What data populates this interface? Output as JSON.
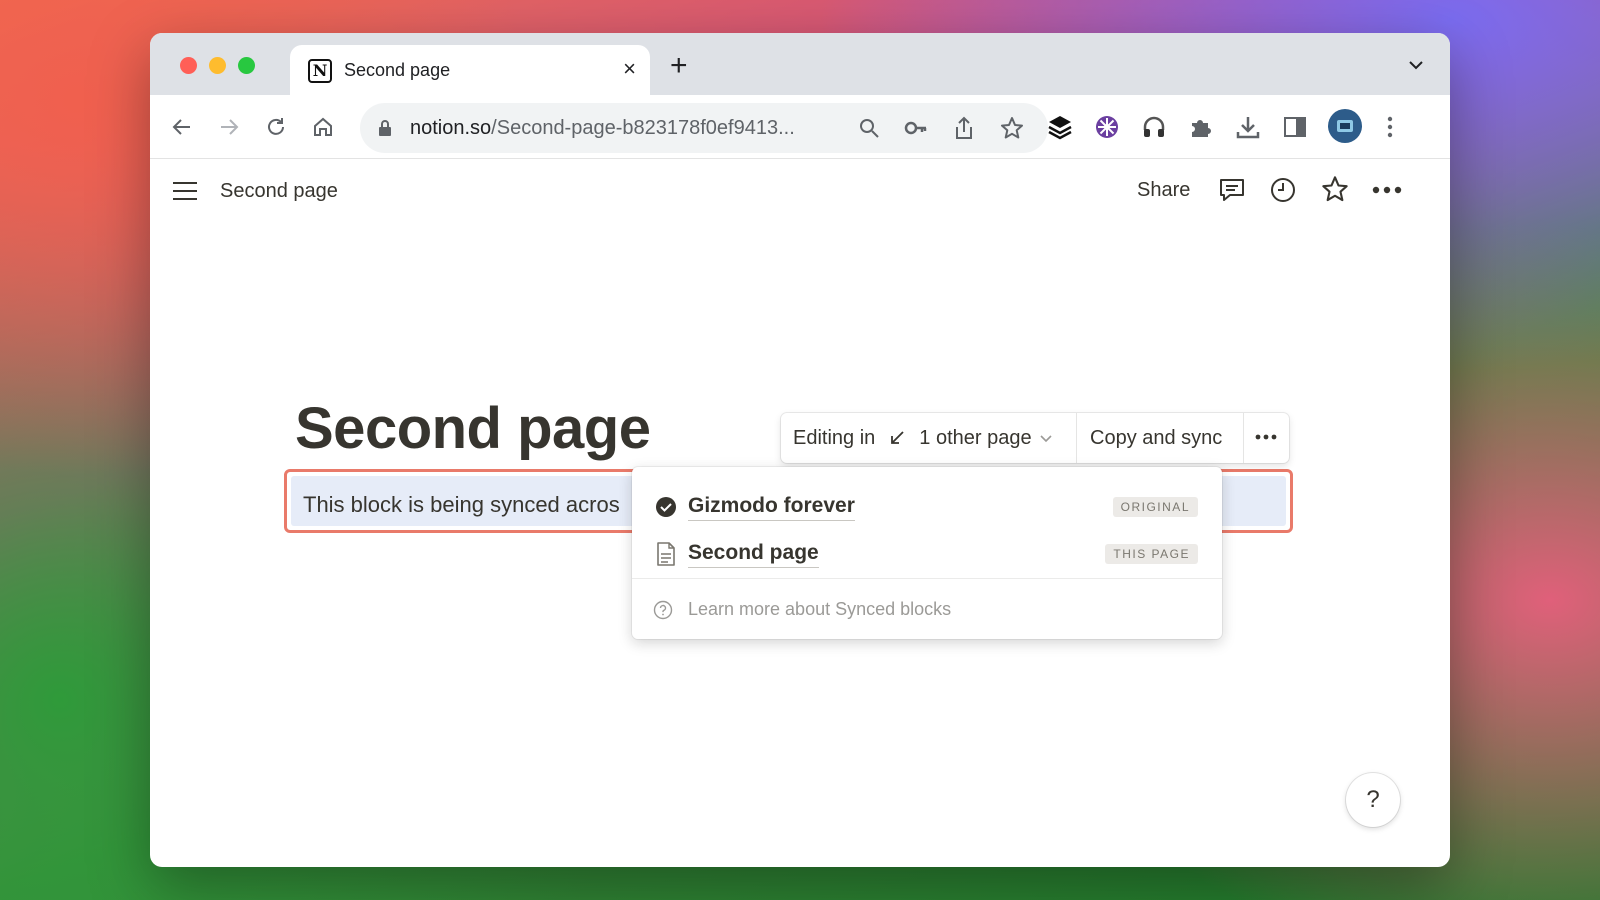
{
  "browser": {
    "tab_title": "Second page",
    "tab_close": "×",
    "new_tab": "+",
    "url_host": "notion.so",
    "url_path": "/Second-page-b823178f0ef9413..."
  },
  "notion": {
    "page_name": "Second page",
    "share_label": "Share",
    "page_title": "Second page",
    "synced_block_text": "This block is being synced acros"
  },
  "sync_toolbar": {
    "editing_in": "Editing in",
    "other_pages": "1 other page",
    "copy_and_sync": "Copy and sync"
  },
  "sync_menu": {
    "items": [
      {
        "label": "Gizmodo forever",
        "badge": "ORIGINAL",
        "icon": "check-circle-icon"
      },
      {
        "label": "Second page",
        "badge": "THIS PAGE",
        "icon": "page-icon"
      }
    ],
    "learn_more": "Learn more about Synced blocks"
  },
  "help_label": "?",
  "colors": {
    "sync_border": "#e97a6a",
    "sync_fill": "#e6ecf8",
    "text": "#37352f"
  }
}
